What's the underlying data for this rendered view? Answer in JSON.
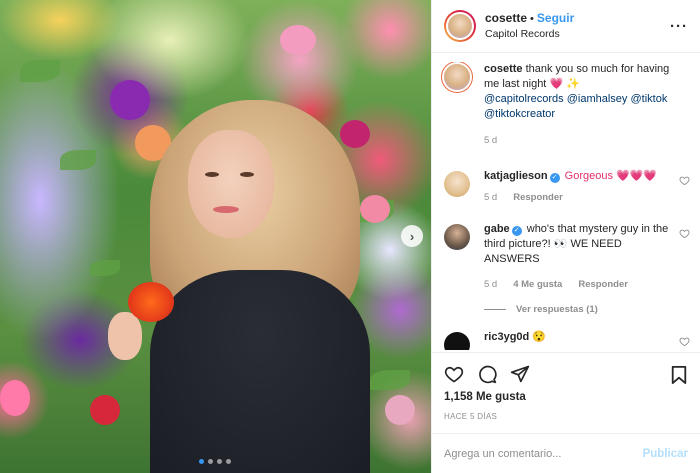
{
  "post": {
    "author": "cosette",
    "follow_separator": "•",
    "follow_label": "Seguir",
    "location": "Capitol Records",
    "more_label": "···"
  },
  "caption": {
    "username": "cosette",
    "text_before": "thank you so much for having me last night",
    "emoji": "💗 ✨",
    "mentions": [
      "@capitolrecords",
      "@iamhalsey",
      "@tiktok",
      "@tiktokcreator"
    ],
    "time": "5 d"
  },
  "comments": [
    {
      "username": "katjaglieson",
      "verified": true,
      "text": "Gorgeous 💗💗💗",
      "time": "5 d",
      "reply_label": "Responder"
    },
    {
      "username": "gabe",
      "verified": true,
      "text": "who's that mystery guy in the third picture?! 👀  WE NEED ANSWERS",
      "time": "5 d",
      "likes_label": "4 Me gusta",
      "reply_label": "Responder",
      "view_replies": "Ver respuestas (1)"
    },
    {
      "username": "ric3yg0d",
      "verified": false,
      "text": "😯"
    }
  ],
  "actions": {
    "likes": "1,158 Me gusta",
    "date": "HACE 5 DÍAS"
  },
  "composer": {
    "placeholder": "Agrega un comentario...",
    "publish_label": "Publicar"
  },
  "carousel": {
    "next_label": "›",
    "count": 4,
    "active_index": 0
  },
  "colors": {
    "accent_blue": "#3897f0",
    "publish_disabled": "#b2dffc",
    "text_primary": "#262626",
    "text_secondary": "#8e8e8e",
    "story_ring": [
      "#f9c94e",
      "#e6683c",
      "#dc2743",
      "#cc2366"
    ]
  },
  "icons": [
    "heart-icon",
    "comment-icon",
    "share-icon",
    "bookmark-icon",
    "verified-icon",
    "more-icon",
    "chevron-right-icon"
  ]
}
